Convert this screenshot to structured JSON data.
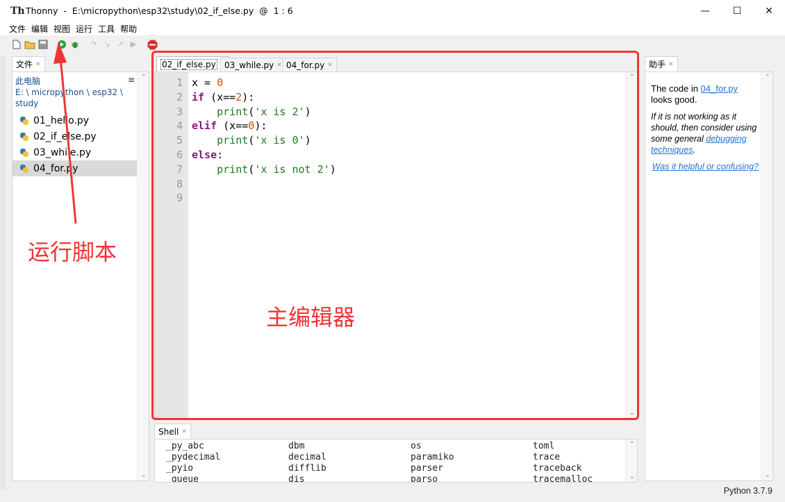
{
  "window": {
    "title": "Thonny  -  E:\\micropython\\esp32\\study\\02_if_else.py  @  1 : 6",
    "minimize": "—",
    "maximize": "☐",
    "close": "✕"
  },
  "menu": [
    "文件",
    "编辑",
    "视图",
    "运行",
    "工具",
    "帮助"
  ],
  "files_panel": {
    "tab_label": "文件",
    "root_label": "此电脑",
    "path": "E: \\ micropython \\ esp32 \\ study",
    "menu_glyph": "≡",
    "items": [
      "01_hello.py",
      "02_if_else.py",
      "03_while.py",
      "04_for.py"
    ]
  },
  "editor": {
    "tabs": [
      "02_if_else.py",
      "03_while.py",
      "04_for.py"
    ],
    "active_tab": 0,
    "line_numbers": [
      "1",
      "2",
      "3",
      "4",
      "5",
      "6",
      "7",
      "8",
      "9"
    ]
  },
  "shell": {
    "tab_label": "Shell",
    "rows": [
      [
        "_py_abc",
        "dbm",
        "os",
        "toml"
      ],
      [
        "_pydecimal",
        "decimal",
        "paramiko",
        "trace"
      ],
      [
        "_pyio",
        "difflib",
        "parser",
        "traceback"
      ],
      [
        "_queue",
        "dis",
        "parso",
        "tracemalloc"
      ]
    ]
  },
  "assistant": {
    "tab_label": "助手",
    "line1_prefix": "The code in ",
    "line1_link": "04_for.py",
    "line1_suffix": " looks good.",
    "italic_text": "If it is not working as it should, then consider using some general ",
    "italic_link": "debugging techniques",
    "italic_end": ".",
    "feedback_link": "Was it helpful or confusing?"
  },
  "statusbar": {
    "interpreter": "Python 3.7.9"
  },
  "annotations": {
    "run_script": "运行脚本",
    "main_editor": "主编辑器"
  },
  "colors": {
    "annotation": "#f03535",
    "keyword": "#8b1a7e",
    "number": "#d35400",
    "string": "#1a7a1a",
    "link": "#2a6fd0"
  }
}
